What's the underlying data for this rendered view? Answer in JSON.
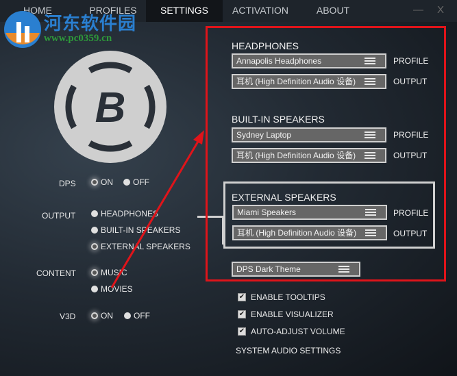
{
  "tabs": [
    {
      "label": "HOME"
    },
    {
      "label": "PROFILES"
    },
    {
      "label": "SETTINGS",
      "selected": true
    },
    {
      "label": "ACTIVATION"
    },
    {
      "label": "ABOUT"
    }
  ],
  "window": {
    "minimize": "—",
    "close": "X"
  },
  "watermark": {
    "title": "河东软件园",
    "url": "www.pc0359.cn"
  },
  "logo": {
    "letter": "B"
  },
  "dps": {
    "label": "DPS",
    "on": "ON",
    "off": "OFF",
    "value": "ON"
  },
  "output": {
    "label": "OUTPUT",
    "options": [
      "HEADPHONES",
      "BUILT-IN SPEAKERS",
      "EXTERNAL SPEAKERS"
    ],
    "value": "EXTERNAL SPEAKERS"
  },
  "content": {
    "label": "CONTENT",
    "options": [
      "MUSIC",
      "MOVIES"
    ],
    "value": "MUSIC"
  },
  "v3d": {
    "label": "V3D",
    "on": "ON",
    "off": "OFF",
    "value": "ON"
  },
  "headphones": {
    "title": "HEADPHONES",
    "profile": "Annapolis Headphones",
    "output": "耳机 (High Definition Audio 设备)"
  },
  "builtin": {
    "title": "BUILT-IN SPEAKERS",
    "profile": "Sydney Laptop",
    "output": "耳机 (High Definition Audio 设备)"
  },
  "external": {
    "title": "EXTERNAL SPEAKERS",
    "profile": "Miami Speakers",
    "output": "耳机 (High Definition Audio 设备)"
  },
  "labels": {
    "profile": "PROFILE",
    "output": "OUTPUT"
  },
  "theme": "DPS Dark Theme",
  "checkboxes": [
    {
      "label": "ENABLE TOOLTIPS",
      "checked": true
    },
    {
      "label": "ENABLE VISUALIZER",
      "checked": true
    },
    {
      "label": "AUTO-ADJUST VOLUME",
      "checked": true
    }
  ],
  "system_audio": "SYSTEM AUDIO SETTINGS",
  "colors": {
    "annotation": "#e0141a",
    "accent": "#d0d0d0"
  }
}
